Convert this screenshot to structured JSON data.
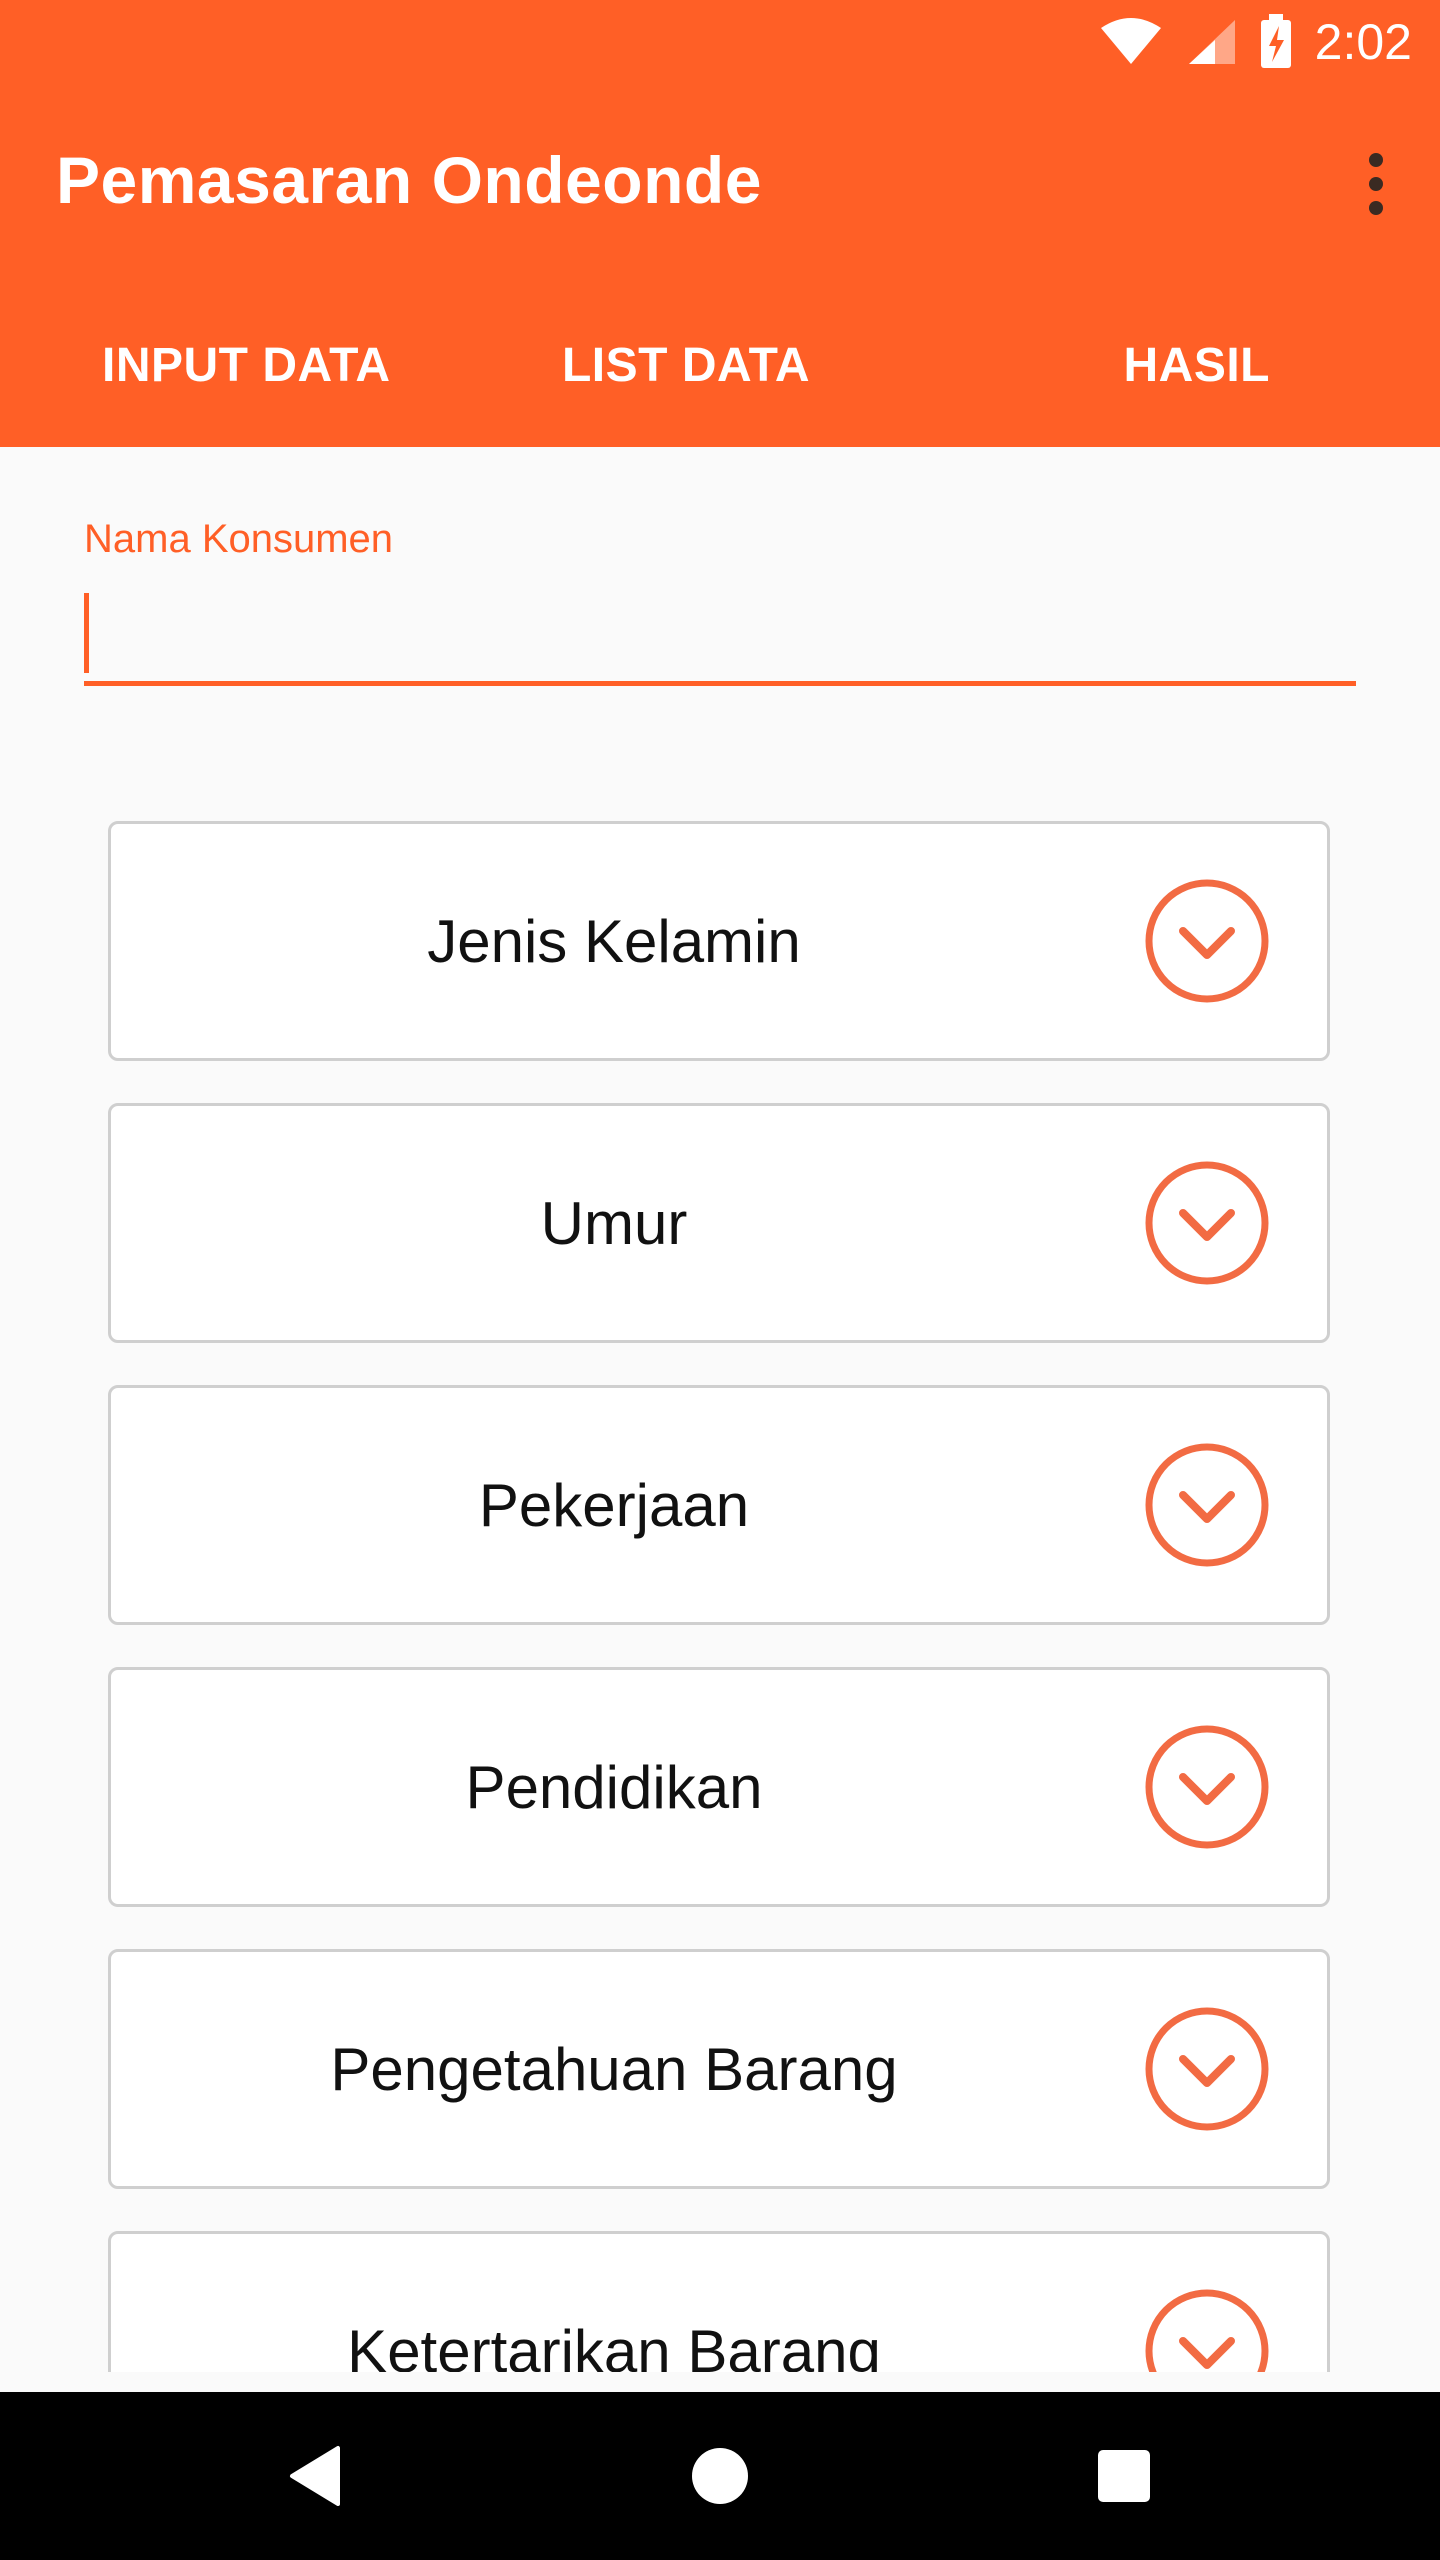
{
  "status_bar": {
    "time": "2:02",
    "icons": [
      "wifi-icon",
      "signal-icon",
      "battery-charging-icon"
    ]
  },
  "toolbar": {
    "title": "Pemasaran Ondeonde",
    "overflow_icon": "more-vert-icon"
  },
  "tabs": [
    {
      "label": "INPUT DATA"
    },
    {
      "label": "LIST DATA"
    },
    {
      "label": "HASIL"
    }
  ],
  "form": {
    "name_field": {
      "label": "Nama Konsumen",
      "value": "",
      "placeholder": ""
    },
    "spinners": [
      {
        "label": "Jenis Kelamin"
      },
      {
        "label": "Umur"
      },
      {
        "label": "Pekerjaan"
      },
      {
        "label": "Pendidikan"
      },
      {
        "label": "Pengetahuan Barang"
      },
      {
        "label": "Ketertarikan Barang"
      }
    ],
    "dropdown_icon": "chevron-down-circle-icon"
  },
  "nav_bar": {
    "back_icon": "back-icon",
    "home_icon": "home-icon",
    "recents_icon": "recents-icon"
  },
  "colors": {
    "accent": "#ff5f26",
    "nav_bar": "#000000",
    "background": "#fafafa"
  }
}
